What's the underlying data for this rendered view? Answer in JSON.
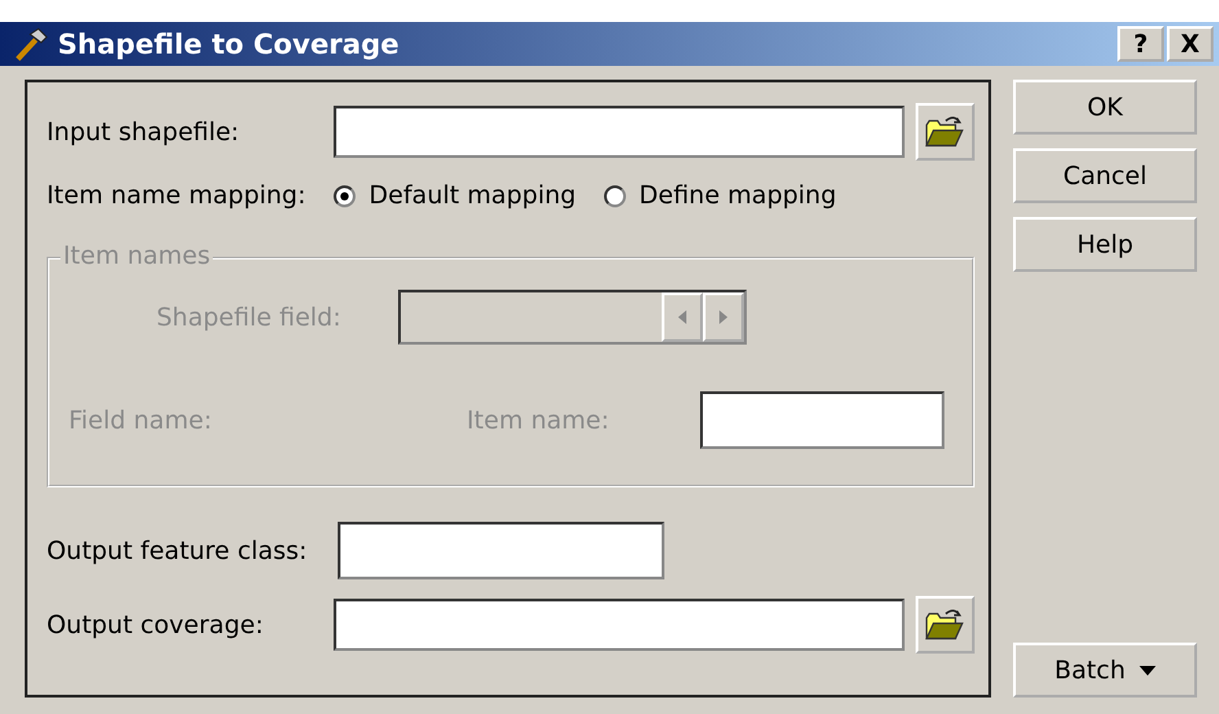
{
  "window": {
    "title": "Shapefile to Coverage",
    "title_buttons": [
      "?",
      "X"
    ]
  },
  "input_shapefile": {
    "label": "Input shapefile:"
  },
  "item_name_mapping": {
    "label": "Item name mapping:",
    "options": [
      {
        "label": "Default mapping",
        "selected": true
      },
      {
        "label": "Define mapping",
        "selected": false
      }
    ]
  },
  "item_names": {
    "title": "Item names",
    "disabled": true,
    "shapefile_field_label": "Shapefile field:",
    "field_name_label": "Field name:",
    "item_name_label": "Item name:"
  },
  "output_feature_class": {
    "label": "Output feature class:"
  },
  "output_coverage": {
    "label": "Output coverage:"
  },
  "buttons": [
    "OK",
    "Cancel",
    "Help"
  ],
  "batch_button": "Batch"
}
